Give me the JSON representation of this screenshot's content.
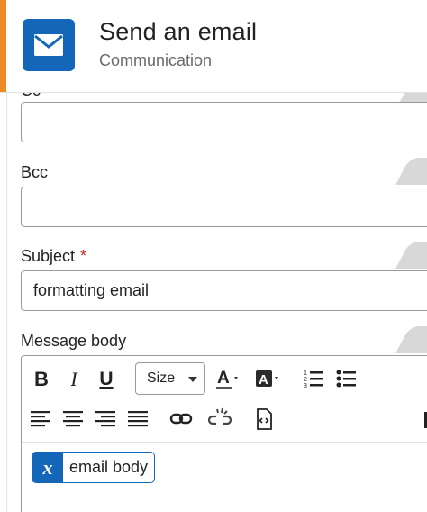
{
  "header": {
    "title": "Send an email",
    "subtitle": "Communication",
    "icon": "envelope-icon",
    "accent_color": "#ee8a26",
    "icon_bg_color": "#1466b8"
  },
  "fields": {
    "cc": {
      "label": "Cc",
      "value": ""
    },
    "bcc": {
      "label": "Bcc",
      "value": ""
    },
    "subject": {
      "label": "Subject",
      "required_mark": "*",
      "value": "formatting email"
    },
    "message_body": {
      "label": "Message body"
    }
  },
  "editor": {
    "toolbar": {
      "bold": "B",
      "italic": "I",
      "underline": "U",
      "size_label": "Size",
      "icons": [
        "font-color-icon",
        "highlight-color-icon",
        "numbered-list-icon",
        "bullet-list-icon",
        "align-left-icon",
        "align-center-icon",
        "align-right-icon",
        "justify-icon",
        "link-icon",
        "unlink-icon",
        "source-code-icon"
      ]
    },
    "variable_chip": {
      "symbol": "x",
      "label": "email body"
    }
  }
}
